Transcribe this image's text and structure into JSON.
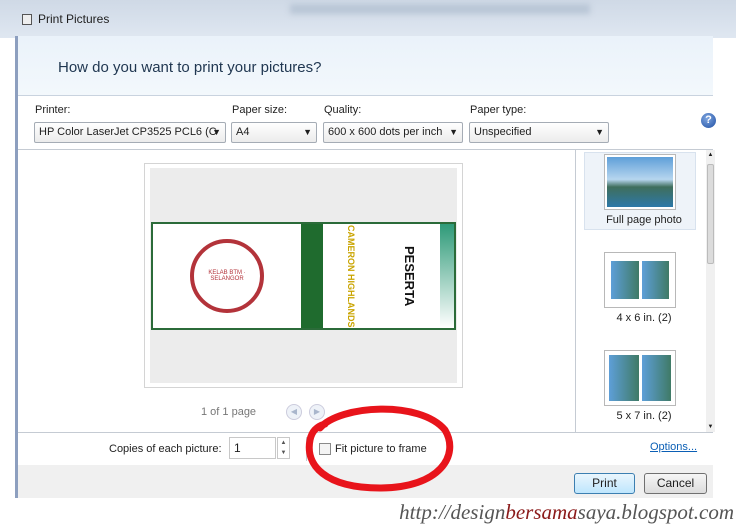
{
  "window": {
    "title": "Print Pictures"
  },
  "header": {
    "question": "How do you want to print your pictures?"
  },
  "options": {
    "printer": {
      "label": "Printer:",
      "value": "HP Color LaserJet CP3525 PCL6 (C"
    },
    "paper_size": {
      "label": "Paper size:",
      "value": "A4"
    },
    "quality": {
      "label": "Quality:",
      "value": "600 x 600 dots per inch"
    },
    "paper_type": {
      "label": "Paper type:",
      "value": "Unspecified"
    },
    "help_icon": "question-circle-icon"
  },
  "preview": {
    "page_indicator": "1 of 1 page",
    "image_text": {
      "left": "KELAB BTM · SELANGOR",
      "middle": "CAMERON HIGHLANDS",
      "right": "PESERTA"
    }
  },
  "layouts": [
    {
      "label": "Full page photo",
      "selected": true
    },
    {
      "label": "4 x 6 in. (2)"
    },
    {
      "label": "5 x 7 in. (2)"
    }
  ],
  "bottom": {
    "copies_label": "Copies of each picture:",
    "copies_value": "1",
    "fit_label": "Fit picture to frame",
    "fit_checked": false,
    "options_link": "Options..."
  },
  "footer": {
    "print": "Print",
    "cancel": "Cancel"
  },
  "watermark": {
    "pre": "http://design",
    "mid": "bersama",
    "post": "saya.blogspot.com"
  },
  "colors": {
    "annotation": "#e8141b",
    "link": "#0b5fb5",
    "watermark_accent": "#8b1a1a"
  }
}
